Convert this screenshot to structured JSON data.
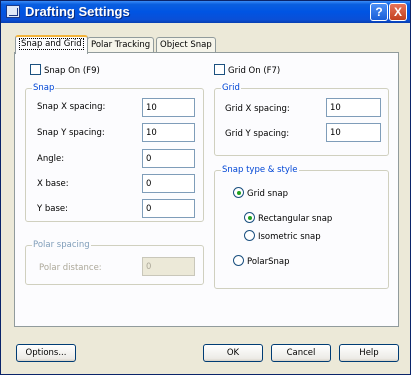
{
  "window": {
    "title": "Drafting Settings"
  },
  "titlebar": {
    "help_label": "?",
    "close_label": "X"
  },
  "tabs": [
    {
      "label": "Snap and Grid"
    },
    {
      "label": "Polar Tracking"
    },
    {
      "label": "Object Snap"
    }
  ],
  "snap": {
    "checkbox_label": "Snap On (F9)",
    "group_title": "Snap",
    "x_spacing_label": "Snap X spacing:",
    "x_spacing_value": "10",
    "y_spacing_label": "Snap Y spacing:",
    "y_spacing_value": "10",
    "angle_label": "Angle:",
    "angle_value": "0",
    "x_base_label": "X base:",
    "x_base_value": "0",
    "y_base_label": "Y base:",
    "y_base_value": "0"
  },
  "polar_spacing": {
    "group_title": "Polar spacing",
    "distance_label": "Polar distance:",
    "distance_value": "0"
  },
  "grid": {
    "checkbox_label": "Grid On (F7)",
    "group_title": "Grid",
    "x_spacing_label": "Grid X spacing:",
    "x_spacing_value": "10",
    "y_spacing_label": "Grid Y spacing:",
    "y_spacing_value": "10"
  },
  "snap_type": {
    "group_title": "Snap type & style",
    "grid_snap_label": "Grid snap",
    "rectangular_label": "Rectangular snap",
    "isometric_label": "Isometric snap",
    "polar_snap_label": "PolarSnap"
  },
  "buttons": {
    "options": "Options...",
    "ok": "OK",
    "cancel": "Cancel",
    "help": "Help"
  }
}
